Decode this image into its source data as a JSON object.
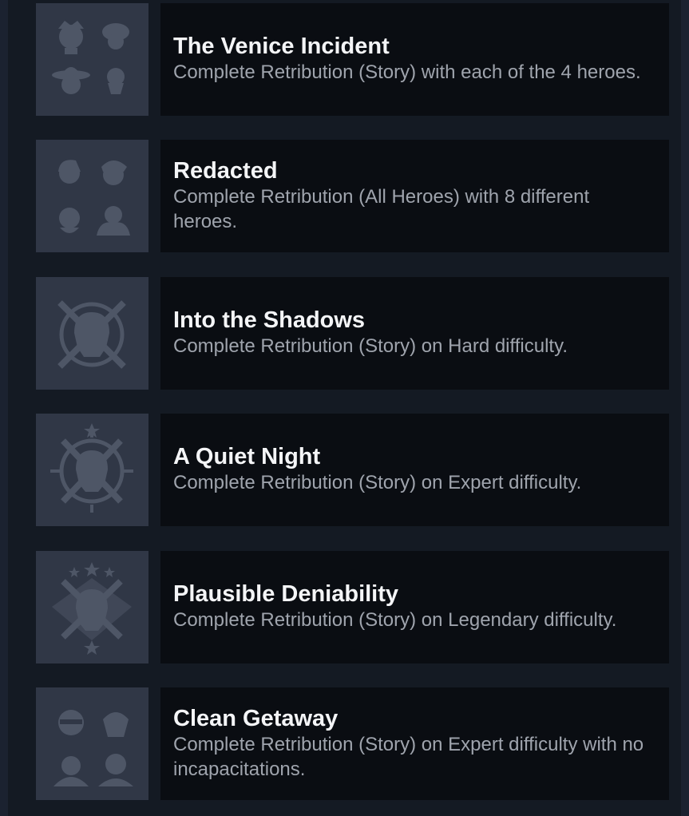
{
  "achievements": [
    {
      "title": "The Venice Incident",
      "description": "Complete Retribution (Story) with each of the 4 heroes."
    },
    {
      "title": "Redacted",
      "description": "Complete Retribution (All Heroes) with 8 different heroes."
    },
    {
      "title": "Into the Shadows",
      "description": "Complete Retribution (Story) on Hard difficulty."
    },
    {
      "title": "A Quiet Night",
      "description": "Complete Retribution (Story) on Expert difficulty."
    },
    {
      "title": "Plausible Deniability",
      "description": "Complete Retribution (Story) on Legendary difficulty."
    },
    {
      "title": "Clean Getaway",
      "description": "Complete Retribution (Story) on Expert difficulty with no incapacitations."
    }
  ],
  "icons": [
    "four-heroes-icon",
    "eight-heroes-icon",
    "hard-skull-swords-icon",
    "expert-skull-swords-icon",
    "legendary-skull-swords-icon",
    "masked-heroes-icon"
  ],
  "colors": {
    "background": "#1b2230",
    "panel": "#141a23",
    "icon_tile": "#303746",
    "card": "#0a0d12",
    "title": "#f4f5f7",
    "description": "#9fa4ad"
  }
}
